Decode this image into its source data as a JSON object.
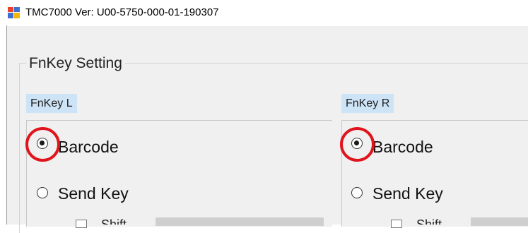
{
  "window": {
    "title": "TMC7000   Ver: U00-5750-000-01-190307",
    "icon": "app-window-icon"
  },
  "group": {
    "title": "FnKey Setting"
  },
  "panels": [
    {
      "label": "FnKey L",
      "options": [
        {
          "label": "Barcode",
          "selected": true,
          "highlighted": true
        },
        {
          "label": "Send Key",
          "selected": false
        }
      ],
      "partial_option": "Shift"
    },
    {
      "label": "FnKey R",
      "options": [
        {
          "label": "Barcode",
          "selected": true,
          "highlighted": true
        },
        {
          "label": "Send Key",
          "selected": false
        }
      ],
      "partial_option": "Shift"
    }
  ],
  "colors": {
    "highlight": "#e0141c",
    "panel_label_bg": "#cde3f6",
    "window_bg": "#f0f0f0"
  }
}
